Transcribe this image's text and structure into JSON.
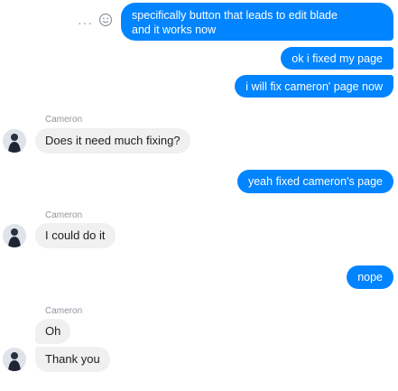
{
  "messages_out": [
    {
      "text_line1": "specifically button that leads to edit blade",
      "text_line2": "and it works now"
    },
    {
      "text": "ok i fixed my page"
    },
    {
      "text": "i will fix cameron' page now"
    },
    {
      "text": "yeah fixed cameron's page"
    },
    {
      "text": "nope"
    }
  ],
  "messages_in": [
    {
      "sender": "Cameron",
      "text": "Does it need much fixing?"
    },
    {
      "sender": "Cameron",
      "text": "I could do it"
    },
    {
      "sender": "Cameron",
      "text": "Oh"
    },
    {
      "text": "Thank you"
    }
  ],
  "tools": {
    "more": "···",
    "emoji_icon": "smiley-face-icon"
  },
  "colors": {
    "outgoing": "#0084ff",
    "incoming": "#f1f0f0",
    "sender_label": "#90949c"
  }
}
